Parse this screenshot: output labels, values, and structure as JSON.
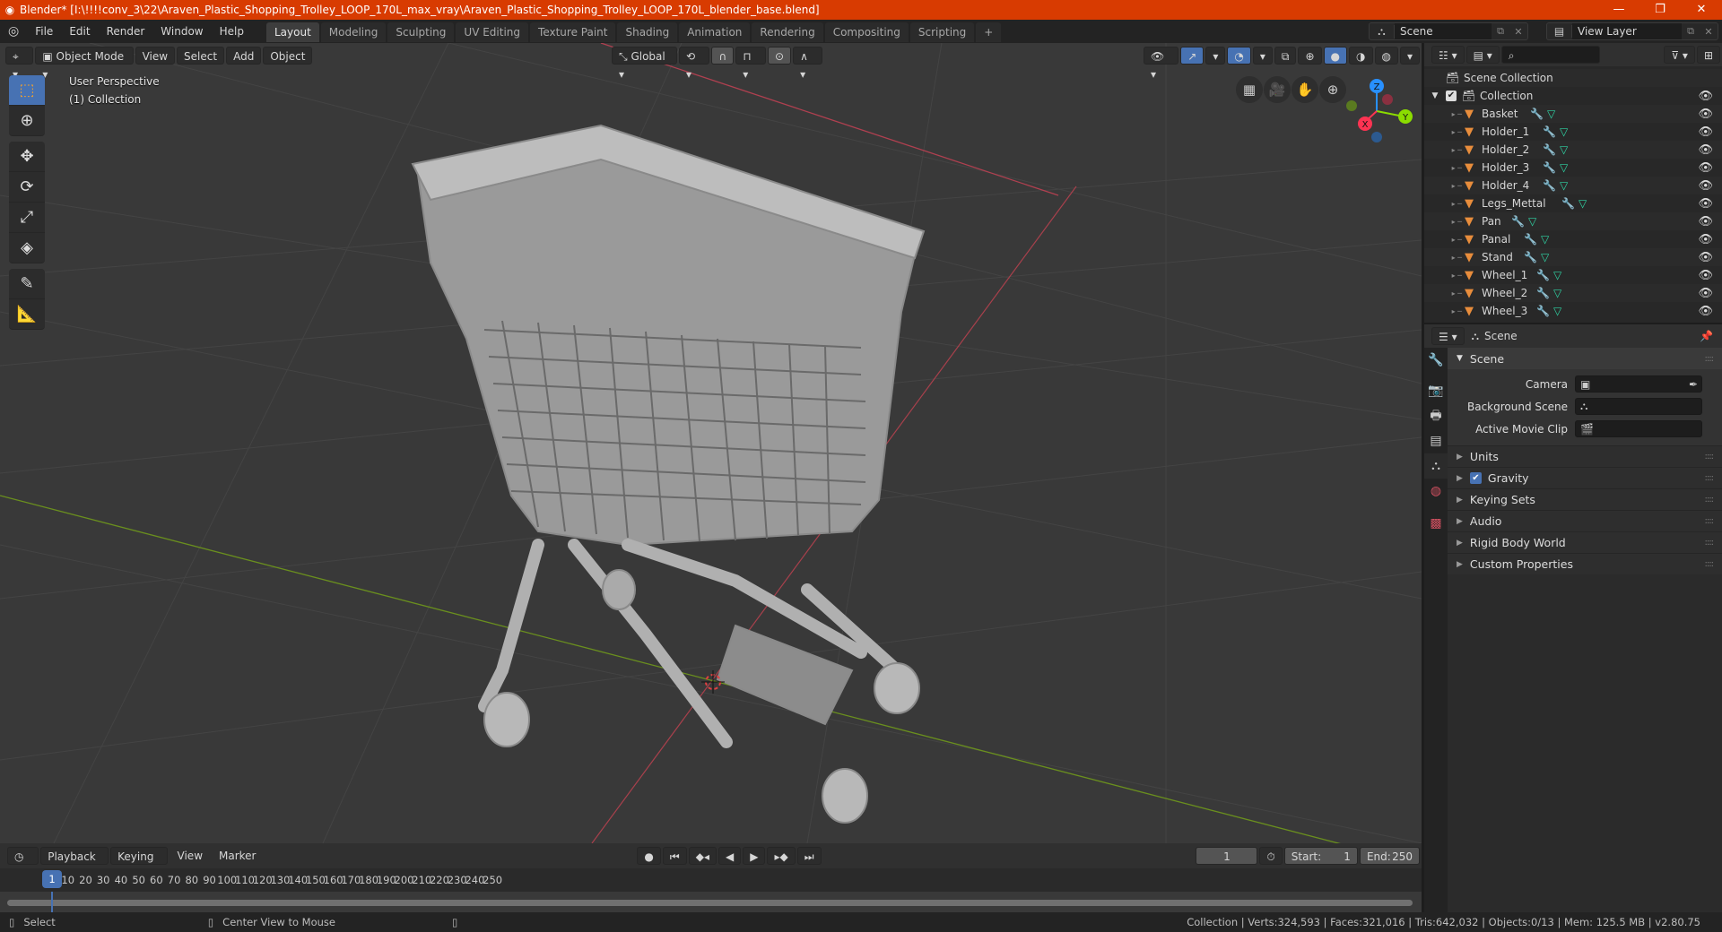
{
  "window": {
    "title": "Blender* [I:\\!!!!conv_3\\22\\Araven_Plastic_Shopping_Trolley_LOOP_170L_max_vray\\Araven_Plastic_Shopping_Trolley_LOOP_170L_blender_base.blend]",
    "controls": {
      "minimize": "—",
      "maximize": "❐",
      "close": "✕"
    }
  },
  "menubar": {
    "items": [
      "File",
      "Edit",
      "Render",
      "Window",
      "Help"
    ],
    "workspaces": [
      "Layout",
      "Modeling",
      "Sculpting",
      "UV Editing",
      "Texture Paint",
      "Shading",
      "Animation",
      "Rendering",
      "Compositing",
      "Scripting"
    ],
    "active_workspace": "Layout",
    "add_workspace": "+",
    "scene": "Scene",
    "view_layer": "View Layer"
  },
  "viewport": {
    "mode": "Object Mode",
    "menus": [
      "View",
      "Select",
      "Add",
      "Object"
    ],
    "orientation": "Global",
    "overlay_title": "User Perspective",
    "overlay_subtitle": "(1) Collection",
    "gizmo": {
      "x": "X",
      "y": "Y",
      "z": "Z",
      "x_color": "#ff3352",
      "y_color": "#8bdc00",
      "z_color": "#2890ff"
    },
    "grid_color": "#444444",
    "background": "#393939"
  },
  "outliner": {
    "root": "Scene Collection",
    "collection": "Collection",
    "objects": [
      "Basket",
      "Holder_1",
      "Holder_2",
      "Holder_3",
      "Holder_4",
      "Legs_Mettal",
      "Pan",
      "Panal",
      "Stand",
      "Wheel_1",
      "Wheel_2",
      "Wheel_3"
    ]
  },
  "properties": {
    "context": "Scene",
    "section": "Scene",
    "fields": [
      {
        "label": "Camera",
        "value": ""
      },
      {
        "label": "Background Scene",
        "value": ""
      },
      {
        "label": "Active Movie Clip",
        "value": ""
      }
    ],
    "panels": [
      "Units",
      "Gravity",
      "Keying Sets",
      "Audio",
      "Rigid Body World",
      "Custom Properties"
    ],
    "gravity_checked": true
  },
  "timeline": {
    "menus": [
      "Playback",
      "Keying",
      "View",
      "Marker"
    ],
    "current_frame": "1",
    "start_label": "Start:",
    "start": "1",
    "end_label": "End:",
    "end": "250",
    "ticks": [
      "10",
      "20",
      "30",
      "40",
      "50",
      "60",
      "70",
      "80",
      "90",
      "100",
      "110",
      "120",
      "130",
      "140",
      "150",
      "160",
      "170",
      "180",
      "190",
      "200",
      "210",
      "220",
      "230",
      "240",
      "250"
    ],
    "playhead": "1"
  },
  "statusbar": {
    "left_action": "Select",
    "middle_action": "Center View to Mouse",
    "stats": "Collection | Verts:324,593 | Faces:321,016 | Tris:642,032 | Objects:0/13 | Mem: 125.5 MB | v2.80.75"
  }
}
